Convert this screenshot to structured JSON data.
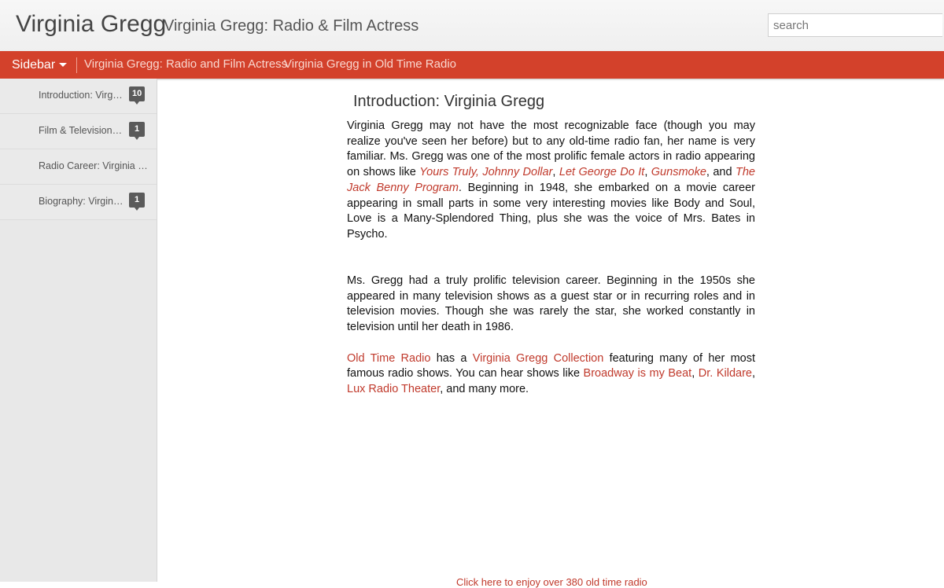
{
  "header": {
    "blog_title": "Virginia Gregg",
    "blog_description": "Virginia Gregg: Radio & Film Actress",
    "search_placeholder": "search"
  },
  "navbar": {
    "sidebar_label": "Sidebar",
    "links": [
      "Virginia Gregg: Radio and Film Actress",
      "Virginia Gregg in Old Time Radio"
    ]
  },
  "sidebar": {
    "items": [
      {
        "label": "Introduction: Virginia Gregg",
        "count": "10"
      },
      {
        "label": "Film & Television Career",
        "count": "1"
      },
      {
        "label": "Radio Career: Virginia Gregg",
        "count": ""
      },
      {
        "label": "Biography: Virginia Gregg",
        "count": "1"
      }
    ]
  },
  "post": {
    "title": "Introduction: Virginia Gregg",
    "p1": {
      "t1": "Virginia Gregg may not have the most recognizable face (though you may realize you've seen her before) but to any old-time radio fan, her name is very familiar.  Ms. Gregg was one of the most prolific female actors in radio appearing on shows like ",
      "l1": "Yours Truly, Johnny Dollar",
      "s1": ", ",
      "l2": "Let George Do It",
      "s2": ", ",
      "l3": "Gunsmoke",
      "s3": ", and ",
      "l4": "The Jack Benny Program",
      "t2": ". Beginning in 1948, she embarked on a movie career appearing in small parts in some very interesting movies like Body and Soul, Love is a Many-Splendored Thing, plus she was the voice of Mrs. Bates in Psycho."
    },
    "p2": "Ms. Gregg had a truly prolific television career.  Beginning in the 1950s she appeared in many television shows as a guest star or in recurring roles and in television movies. Though she was rarely the star, she worked constantly in television until her death in 1986.",
    "p3": {
      "l1": "Old Time Radio",
      "t1": " has a ",
      "l2": "Virginia Gregg Collection",
      "t2": " featuring many of her most famous radio shows. You can hear shows like ",
      "l3": "Broadway is my Beat",
      "s1": ", ",
      "l4": "Dr. Kildare",
      "s2": ", ",
      "l5": "Lux Radio Theater",
      "t3": ", and many more."
    },
    "footer_link": "Click here to enjoy over 380 old time radio"
  },
  "colors": {
    "navbar_bg": "#d3412b",
    "link": "#c0392b",
    "badge_bg": "#5a5a5a",
    "sidebar_bg": "#e8e8e8"
  }
}
